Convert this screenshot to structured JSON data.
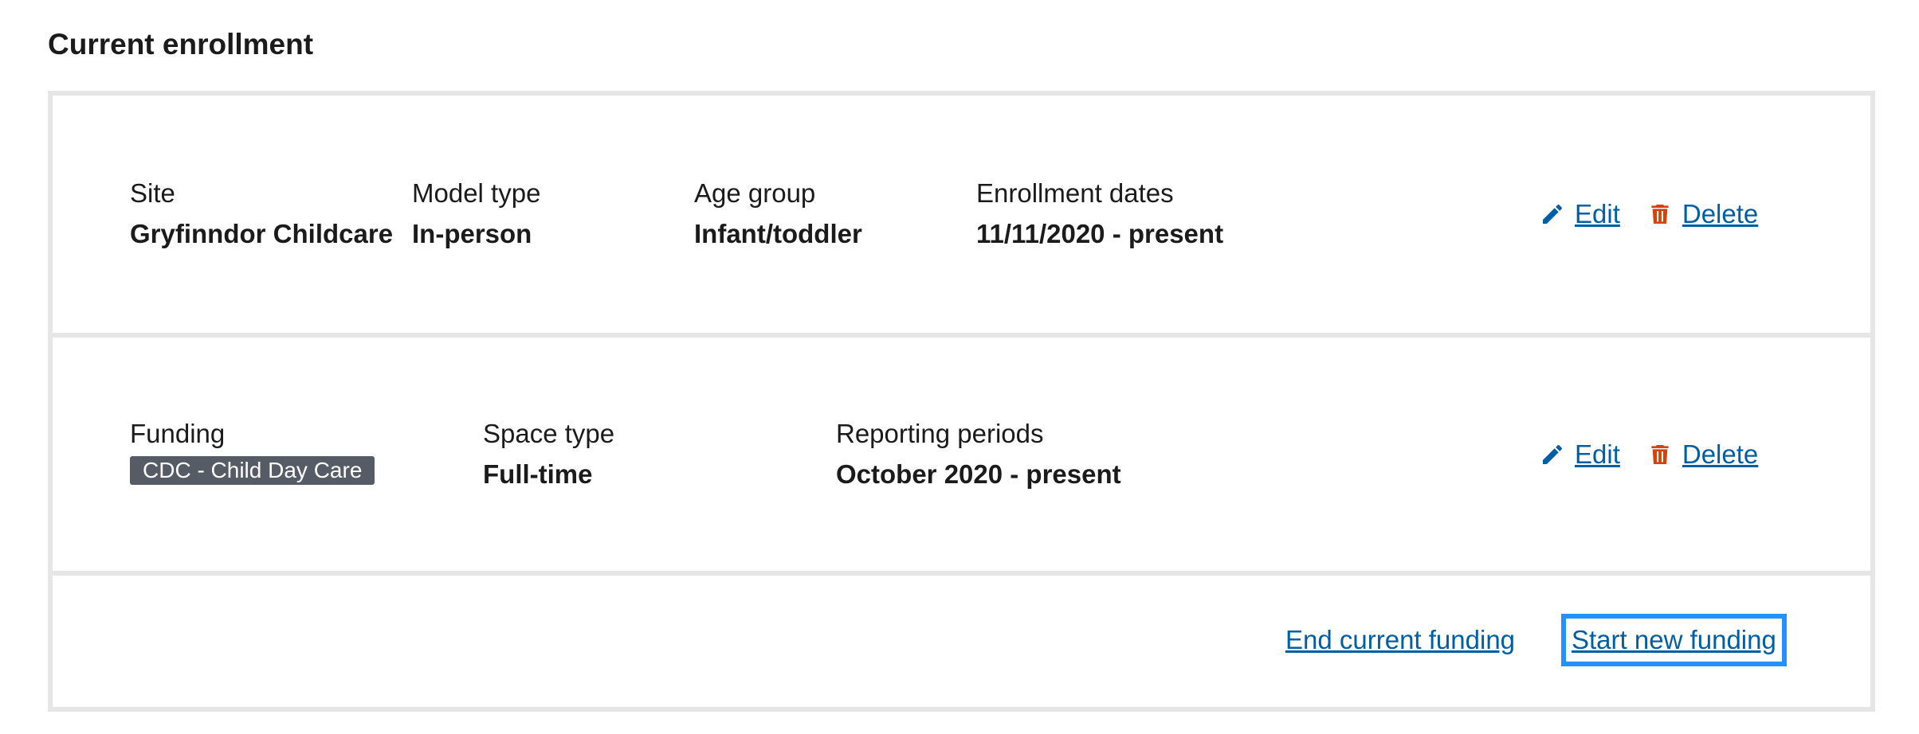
{
  "section": {
    "title": "Current enrollment"
  },
  "enrollment": {
    "site": {
      "label": "Site",
      "value": "Gryfinndor Childcare"
    },
    "model_type": {
      "label": "Model type",
      "value": "In-person"
    },
    "age_group": {
      "label": "Age group",
      "value": "Infant/toddler"
    },
    "enrollment_dates": {
      "label": "Enrollment dates",
      "value": "11/11/2020 - present"
    },
    "edit_label": "Edit",
    "delete_label": "Delete"
  },
  "funding": {
    "funding": {
      "label": "Funding",
      "tag": "CDC - Child Day Care"
    },
    "space_type": {
      "label": "Space type",
      "value": "Full-time"
    },
    "reporting_periods": {
      "label": "Reporting periods",
      "value": "October 2020 - present"
    },
    "edit_label": "Edit",
    "delete_label": "Delete"
  },
  "footer_actions": {
    "end_funding_label": "End current funding",
    "start_funding_label": "Start new funding"
  },
  "icons": {
    "edit": "pencil-icon",
    "delete": "trash-icon"
  },
  "colors": {
    "link": "#005ea2",
    "delete_icon": "#d54309",
    "tag_background": "#565c65",
    "focus_outline": "#2491ff",
    "border": "#e6e6e6"
  }
}
